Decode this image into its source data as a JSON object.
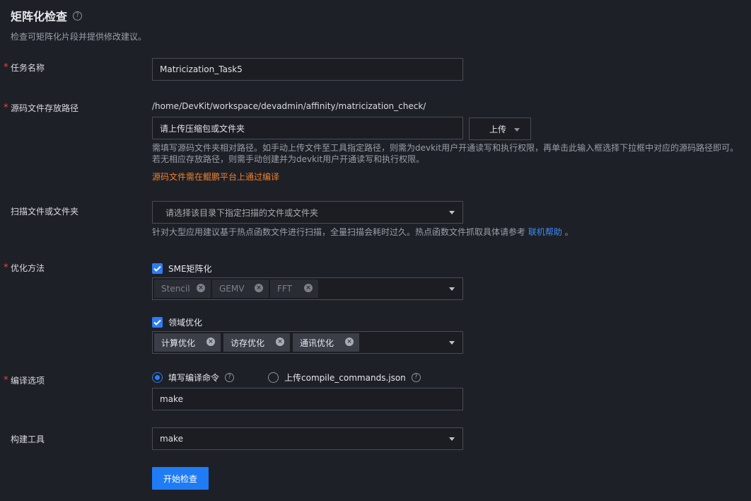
{
  "header": {
    "title": "矩阵化检查",
    "help_icon": "?",
    "subtitle": "检查可矩阵化片段并提供修改建议。"
  },
  "form": {
    "required_mark": "*",
    "task_name": {
      "label": "任务名称",
      "value": "Matricization_Task5"
    },
    "source_path": {
      "label": "源码文件存放路径",
      "base_path": "/home/DevKit/workspace/devadmin/affinity/matricization_check/",
      "input_value": "请上传压缩包或文件夹",
      "upload_label": "上传",
      "hint_line1": "需填写源码文件夹相对路径。如手动上传文件至工具指定路径，则需为devkit用户开通读写和执行权限，再单击此输入框选择下拉框中对应的源码路径即可。",
      "hint_line2": "若无相应存放路径，则需手动创建并为devkit用户开通读写和执行权限。",
      "warning": "源码文件需在鲲鹏平台上通过编译"
    },
    "scan": {
      "label": "扫描文件或文件夹",
      "placeholder": "请选择该目录下指定扫描的文件或文件夹",
      "hint_text": "针对大型应用建议基于热点函数文件进行扫描，全量扫描会耗时过久。热点函数文件抓取具体请参考 ",
      "hint_link": "联机帮助",
      "hint_end": " 。"
    },
    "optimization": {
      "label": "优化方法",
      "sme": {
        "label": "SME矩阵化",
        "checked": true,
        "tags": [
          "Stencil",
          "GEMV",
          "FFT"
        ]
      },
      "domain": {
        "label": "领域优化",
        "checked": true,
        "tags": [
          "计算优化",
          "访存优化",
          "通讯优化"
        ]
      }
    },
    "compile": {
      "label": "编译选项",
      "radio_fill": "填写编译命令",
      "radio_upload": "上传compile_commands.json",
      "selected": "fill",
      "command_value": "make"
    },
    "build_tool": {
      "label": "构建工具",
      "value": "make"
    },
    "submit_label": "开始检查"
  },
  "colors": {
    "background": "#1e2027",
    "accent": "#1f7cf5",
    "required": "#f0443a",
    "warning": "#f07f2a"
  }
}
